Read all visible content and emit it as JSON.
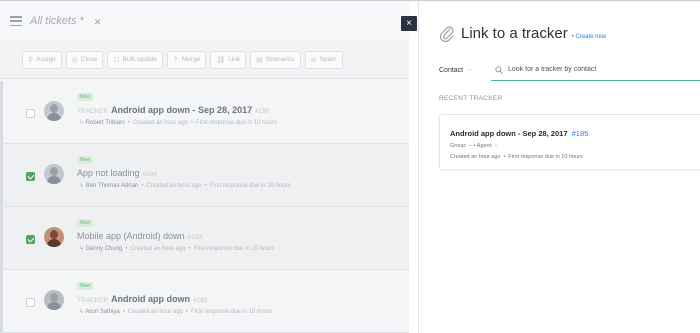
{
  "list_view": {
    "title": "All tickets *",
    "close_glyph": "×",
    "toolbar": [
      {
        "icon": "assign-icon",
        "glyph": "⚲",
        "label": "Assign"
      },
      {
        "icon": "close-ticket-icon",
        "glyph": "◎",
        "label": "Close"
      },
      {
        "icon": "bulk-update-icon",
        "glyph": "☐",
        "label": "Bulk update"
      },
      {
        "icon": "merge-icon",
        "glyph": "⇡",
        "label": "Merge"
      },
      {
        "icon": "link-icon",
        "glyph": "⛓",
        "label": "Link"
      },
      {
        "icon": "scenarios-icon",
        "glyph": "▤",
        "label": "Scenarios"
      },
      {
        "icon": "spam-icon",
        "glyph": "⊘",
        "label": "Spam"
      }
    ],
    "tickets": [
      {
        "badge": "New",
        "prefix": "TRACKER",
        "title": "Android app down - Sep 28, 2017",
        "number": "#190",
        "requester": "Robert Tribiani",
        "created": "Created an hour ago",
        "due": "First response due in 10 hours",
        "checked": false
      },
      {
        "badge": "New",
        "prefix": "",
        "title": "App not loading",
        "number": "#184",
        "requester": "Ben Thomas Adrian",
        "created": "Created an hour ago",
        "due": "First response due in 10 hours",
        "checked": true
      },
      {
        "badge": "New",
        "prefix": "",
        "title": "Mobile app (Android) down",
        "number": "#183",
        "requester": "Denny Chung",
        "created": "Created an hour ago",
        "due": "First response due in 10 hours",
        "checked": true
      },
      {
        "badge": "New",
        "prefix": "TRACKER",
        "title": "Android app down",
        "number": "#182",
        "requester": "Arun Sathiya",
        "created": "Created an hour ago",
        "due": "First response due in 10 hours",
        "checked": false
      }
    ]
  },
  "panel_close_glyph": "×",
  "tracker_panel": {
    "title": "Link to a tracker",
    "create_new": "• Create new",
    "context_select": "Contact",
    "search_placeholder": "Look for a tracker by contact",
    "section_label": "RECENT TRACKER",
    "recent": {
      "title": "Android app down - Sep 28, 2017",
      "number": "#185",
      "group_agent": "Group: -- • Agent: --",
      "created": "Created an hour ago",
      "due": "First response due in 10 hours"
    }
  },
  "colors": {
    "accent_green": "#52a463",
    "link_blue": "#2c7be5",
    "search_underline": "#53b3a0",
    "dark_button": "#2a3340"
  }
}
